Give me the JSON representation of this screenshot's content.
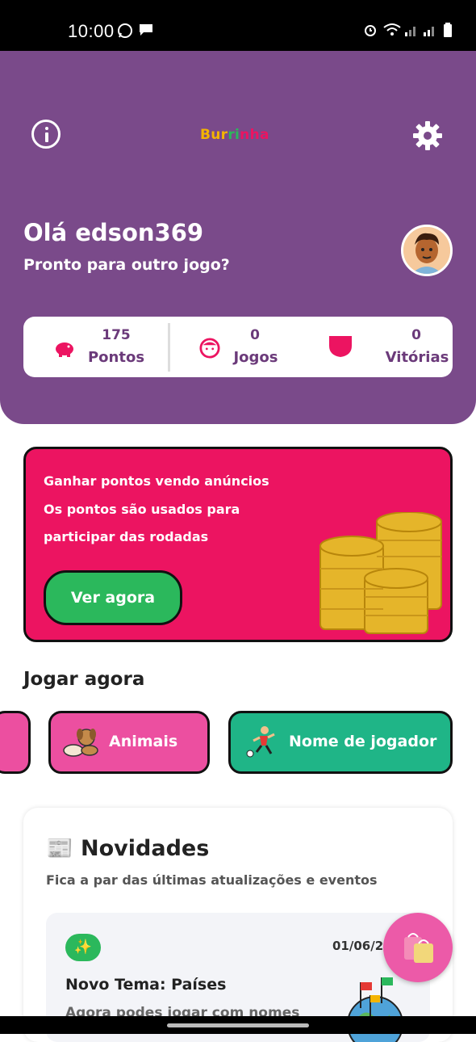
{
  "status_bar": {
    "time": "10:00"
  },
  "header": {
    "logo_parts": [
      "Bur",
      "ri",
      "nha"
    ],
    "logo_colors": [
      "#f4b400",
      "#e53935",
      "#2bb85c",
      "#ec1461"
    ],
    "greeting": "Olá edson369",
    "subtitle": "Pronto para outro jogo?"
  },
  "stats": [
    {
      "value": "175",
      "label": "Pontos",
      "icon": "piggy-bank-icon"
    },
    {
      "value": "0",
      "label": "Jogos",
      "icon": "face-icon"
    },
    {
      "value": "0",
      "label": "Vitórias",
      "icon": "trophy-icon"
    }
  ],
  "promo": {
    "line1": "Ganhar pontos vendo anúncios",
    "line2": "Os pontos são usados para",
    "line3": "participar das rodadas",
    "button": "Ver agora"
  },
  "play": {
    "title": "Jogar agora",
    "categories": [
      {
        "label": "Animais",
        "color": "#ec4fa0"
      },
      {
        "label": "Nome de jogador",
        "color": "#1fb587"
      }
    ]
  },
  "news": {
    "title": "📰 Novidades",
    "subtitle": "Fica a par das últimas atualizações e eventos",
    "card": {
      "badge": "✨",
      "date": "01/06/2",
      "headline": "Novo Tema: Países",
      "body": "Agora podes jogar com nomes"
    }
  },
  "colors": {
    "primary": "#7a4a8a",
    "accent": "#ec1461",
    "success": "#2bb85c"
  }
}
